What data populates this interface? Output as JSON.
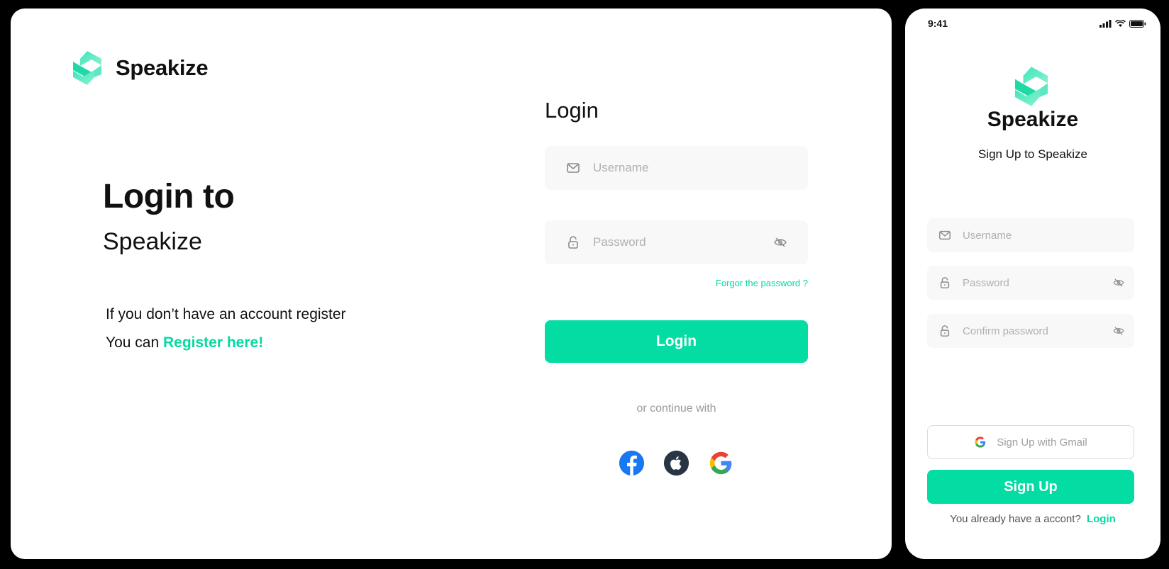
{
  "colors": {
    "accent": "#03dca3",
    "text": "#111111",
    "muted": "#9a9a9a",
    "field_bg": "#f8f8f8"
  },
  "desktop": {
    "brand": {
      "name": "Speakize",
      "logo_icon": "speakize-logo-icon"
    },
    "hero": {
      "title": "Login to",
      "subtitle": "Speakize",
      "line1": "If you don’t have an account register",
      "line2_prefix": "You can",
      "register_link": "Register here!"
    },
    "form": {
      "heading": "Login",
      "username_placeholder": "Username",
      "password_placeholder": "Password",
      "forgot_link": "Forgor the password ?",
      "login_button": "Login",
      "continue_text": "or continue with",
      "social": [
        "facebook-icon",
        "apple-icon",
        "google-icon"
      ]
    }
  },
  "mobile": {
    "status": {
      "time": "9:41"
    },
    "brand": {
      "name": "Speakize"
    },
    "subtitle": "Sign Up to Speakize",
    "form": {
      "username_placeholder": "Username",
      "password_placeholder": "Password",
      "confirm_placeholder": "Confirm password",
      "gmail_button": "Sign Up with Gmail",
      "signup_button": "Sign Up"
    },
    "footer": {
      "prefix": "You already have a accont?",
      "login_link": "Login"
    }
  }
}
